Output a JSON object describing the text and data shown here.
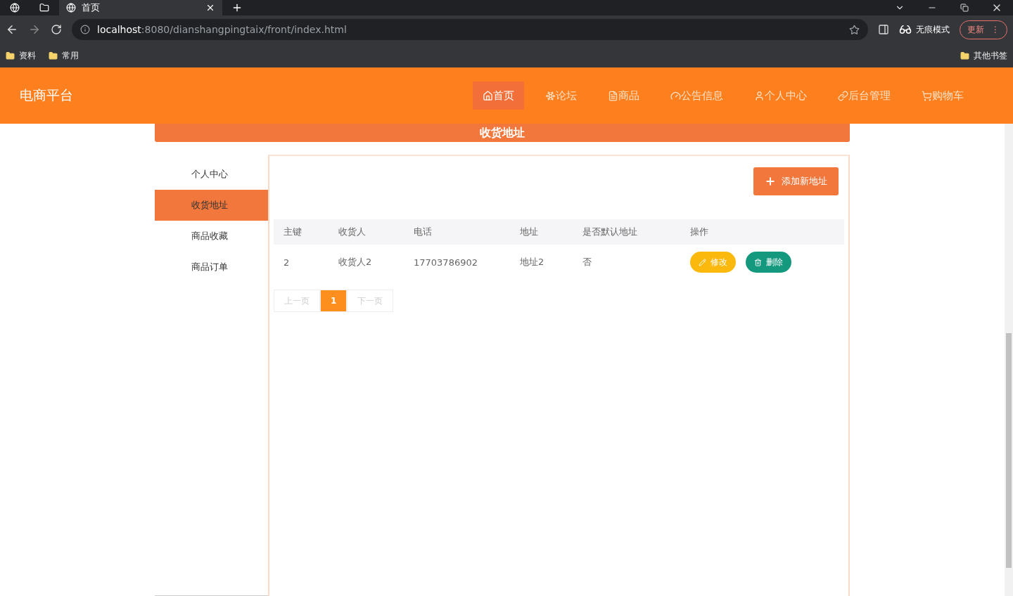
{
  "browser": {
    "tabs": [
      {
        "title": "首页",
        "selected": true
      }
    ],
    "url_host": "localhost",
    "url_rest": ":8080/dianshangpingtaix/front/index.html",
    "profile": "无痕模式",
    "update": "更新",
    "menu_glyph": "⋮",
    "bookmarks": [
      "资料",
      "常用"
    ],
    "other_bookmarks": "其他书签"
  },
  "site": {
    "logo": "电商平台",
    "nav": [
      {
        "label": "首页",
        "selected": true
      },
      {
        "label": "论坛",
        "selected": false
      },
      {
        "label": "商品",
        "selected": false
      },
      {
        "label": "公告信息",
        "selected": false
      },
      {
        "label": "个人中心",
        "selected": false
      },
      {
        "label": "后台管理",
        "selected": false
      },
      {
        "label": "购物车",
        "selected": false
      }
    ]
  },
  "banner": "收货地址",
  "sidebar": [
    {
      "label": "个人中心",
      "selected": false
    },
    {
      "label": "收货地址",
      "selected": true
    },
    {
      "label": "商品收藏",
      "selected": false
    },
    {
      "label": "商品订单",
      "selected": false
    }
  ],
  "add_button": "添加新地址",
  "table": {
    "columns": [
      "主键",
      "收货人",
      "电话",
      "地址",
      "是否默认地址",
      "操作"
    ],
    "rows": [
      {
        "cells": [
          "2",
          "收货人2",
          "17703786902",
          "地址2",
          "否"
        ],
        "actions": [
          {
            "kind": "edit",
            "label": "修改"
          },
          {
            "kind": "delete",
            "label": "删除"
          }
        ]
      }
    ]
  },
  "pagination": {
    "prev": "上一页",
    "pages": [
      {
        "label": "1",
        "selected": true
      }
    ],
    "next": "下一页"
  }
}
